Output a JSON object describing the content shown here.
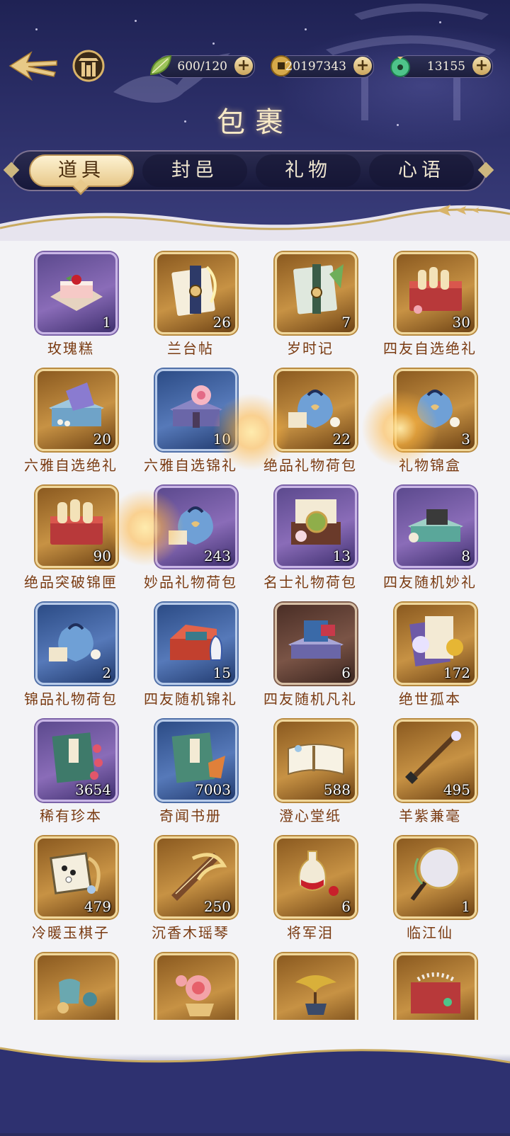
{
  "header": {
    "title": "包裹",
    "resources": [
      {
        "name": "stamina",
        "value": "600/120",
        "icon": "leaf-icon"
      },
      {
        "name": "coins",
        "value": "20197343",
        "icon": "coin-icon"
      },
      {
        "name": "jade",
        "value": "13155",
        "icon": "jade-icon"
      }
    ],
    "plus_label": "+"
  },
  "tabs": [
    {
      "label": "道具",
      "active": true
    },
    {
      "label": "封邑",
      "active": false
    },
    {
      "label": "礼物",
      "active": false
    },
    {
      "label": "心语",
      "active": false
    }
  ],
  "items": [
    {
      "name": "玫瑰糕",
      "count": "1",
      "rarity": "purple"
    },
    {
      "name": "兰台帖",
      "count": "26",
      "rarity": "gold"
    },
    {
      "name": "岁时记",
      "count": "7",
      "rarity": "gold"
    },
    {
      "name": "四友自选绝礼",
      "count": "30",
      "rarity": "gold"
    },
    {
      "name": "六雅自选绝礼",
      "count": "20",
      "rarity": "gold"
    },
    {
      "name": "六雅自选锦礼",
      "count": "10",
      "rarity": "blue"
    },
    {
      "name": "绝品礼物荷包",
      "count": "22",
      "rarity": "gold"
    },
    {
      "name": "礼物锦盒",
      "count": "3",
      "rarity": "gold"
    },
    {
      "name": "绝品突破锦匣",
      "count": "90",
      "rarity": "gold"
    },
    {
      "name": "妙品礼物荷包",
      "count": "243",
      "rarity": "purple"
    },
    {
      "name": "名士礼物荷包",
      "count": "13",
      "rarity": "purple"
    },
    {
      "name": "四友随机妙礼",
      "count": "8",
      "rarity": "purple"
    },
    {
      "name": "锦品礼物荷包",
      "count": "2",
      "rarity": "blue"
    },
    {
      "name": "四友随机锦礼",
      "count": "15",
      "rarity": "blue"
    },
    {
      "name": "四友随机凡礼",
      "count": "6",
      "rarity": "brown"
    },
    {
      "name": "绝世孤本",
      "count": "172",
      "rarity": "gold"
    },
    {
      "name": "稀有珍本",
      "count": "3654",
      "rarity": "purple"
    },
    {
      "name": "奇闻书册",
      "count": "7003",
      "rarity": "blue"
    },
    {
      "name": "澄心堂纸",
      "count": "588",
      "rarity": "gold"
    },
    {
      "name": "羊紫兼毫",
      "count": "495",
      "rarity": "gold"
    },
    {
      "name": "冷暖玉棋子",
      "count": "479",
      "rarity": "gold"
    },
    {
      "name": "沉香木瑶琴",
      "count": "250",
      "rarity": "gold"
    },
    {
      "name": "将军泪",
      "count": "6",
      "rarity": "gold"
    },
    {
      "name": "临江仙",
      "count": "1",
      "rarity": "gold"
    },
    {
      "name": "",
      "count": "",
      "rarity": "gold"
    },
    {
      "name": "",
      "count": "",
      "rarity": "gold"
    },
    {
      "name": "",
      "count": "",
      "rarity": "gold"
    },
    {
      "name": "",
      "count": "",
      "rarity": "gold"
    }
  ],
  "colors": {
    "header_bg": "#2b2e67",
    "content_bg": "#f3f3f6",
    "item_name": "#7a3b12",
    "tab_active": "#e8c98b"
  }
}
